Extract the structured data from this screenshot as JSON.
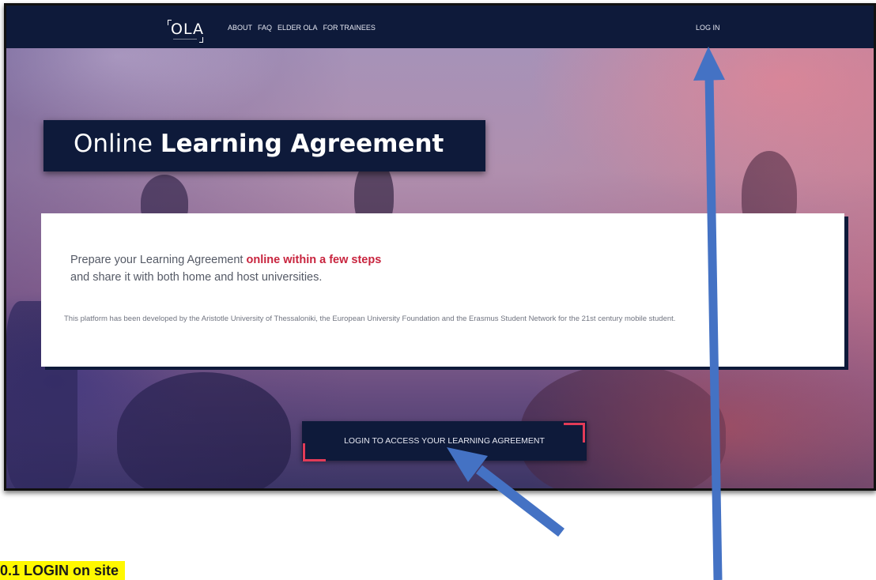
{
  "navbar": {
    "logo_text": "OLA",
    "links": [
      "ABOUT",
      "FAQ",
      "ELDER OLA",
      "FOR TRAINEES"
    ],
    "login_label": "LOG IN"
  },
  "hero": {
    "title_light": "Online",
    "title_bold": "Learning Agreement"
  },
  "info_card": {
    "line1_prefix": "Prepare your Learning Agreement",
    "line1_highlight": "online within a few steps",
    "line2": "and share it with both home and host universities.",
    "note": "This platform has been developed by the Aristotle University of Thessaloniki, the European University Foundation and the Erasmus Student Network for the 21st century mobile student."
  },
  "cta": {
    "label": "LOGIN TO ACCESS YOUR LEARNING AGREEMENT"
  },
  "annotation": {
    "caption": "0.1 LOGIN on site",
    "highlight_color": "#fff800",
    "arrow_color": "#4472c4"
  },
  "colors": {
    "navy": "#0e1a3a",
    "accent_red": "#c8243e",
    "corner_red": "#e23b57"
  }
}
